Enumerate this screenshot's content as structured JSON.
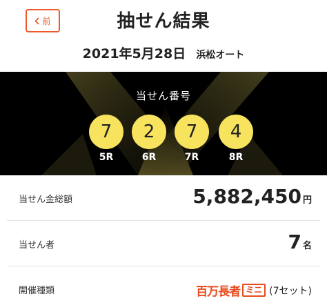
{
  "header": {
    "back_label": "前",
    "title": "抽せん結果",
    "date": "2021年5月28日",
    "venue": "浜松オート"
  },
  "stage": {
    "label": "当せん番号",
    "balls": [
      {
        "number": "7",
        "race": "5R"
      },
      {
        "number": "2",
        "race": "6R"
      },
      {
        "number": "7",
        "race": "7R"
      },
      {
        "number": "4",
        "race": "8R"
      }
    ]
  },
  "results": {
    "prize_label": "当せん金総額",
    "prize_amount": "5,882,450",
    "prize_unit": "円",
    "winners_label": "当せん者",
    "winners_count": "7",
    "winners_unit": "名",
    "type_label": "開催種類",
    "type_brand": "百万長者",
    "type_mini": "ミニ",
    "type_set": "(7セット)"
  },
  "colors": {
    "accent": "#f0582a",
    "ball": "#f7e35e",
    "stage_bg": "#000000"
  },
  "icons": {
    "back": "chevron-left-icon"
  }
}
